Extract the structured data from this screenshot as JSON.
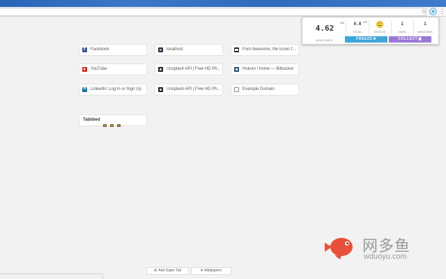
{
  "popup": {
    "available": {
      "value": "4.62",
      "unit": "GB",
      "label": "AVAILABLE"
    },
    "total": {
      "value": "8.0",
      "unit": "GB",
      "label": "TOTAL"
    },
    "status": {
      "label": "STATUS",
      "icon": "smiley-icon"
    },
    "tabs": {
      "value": "1",
      "label": "TABS"
    },
    "windows": {
      "value": "1",
      "label": "WINDOWS"
    },
    "freeze_label": "FREEZE",
    "collect_label": "COLLECT",
    "freeze_color": "#3ea6dc",
    "collect_color": "#9a78d8"
  },
  "shortcuts": [
    {
      "title": "Facebook",
      "icon": "facebook-icon"
    },
    {
      "title": "localhost",
      "icon": "localhost-icon"
    },
    {
      "title": "Font Awesome, the iconic f...",
      "icon": "font-awesome-icon"
    },
    {
      "title": "YouTube",
      "icon": "youtube-icon"
    },
    {
      "title": "Unsplash API | Free HD Ph...",
      "icon": "camera-icon"
    },
    {
      "title": "Hukum / home — Bitbucket",
      "icon": "bitbucket-icon"
    },
    {
      "title": "LinkedIn: Log In or Sign Up",
      "icon": "linkedin-icon"
    },
    {
      "title": "Unsplash API | Free HD Ph...",
      "icon": "camera-icon"
    },
    {
      "title": "Example Domain",
      "icon": "document-icon"
    }
  ],
  "group": {
    "title": "Tabbbed"
  },
  "bottom": {
    "add_super_tab": "Add Super Tab",
    "wallpapers": "Wallpapers"
  },
  "watermark": {
    "name": "网多鱼",
    "domain": "wduoyu.com",
    "color": "#e8503a"
  }
}
